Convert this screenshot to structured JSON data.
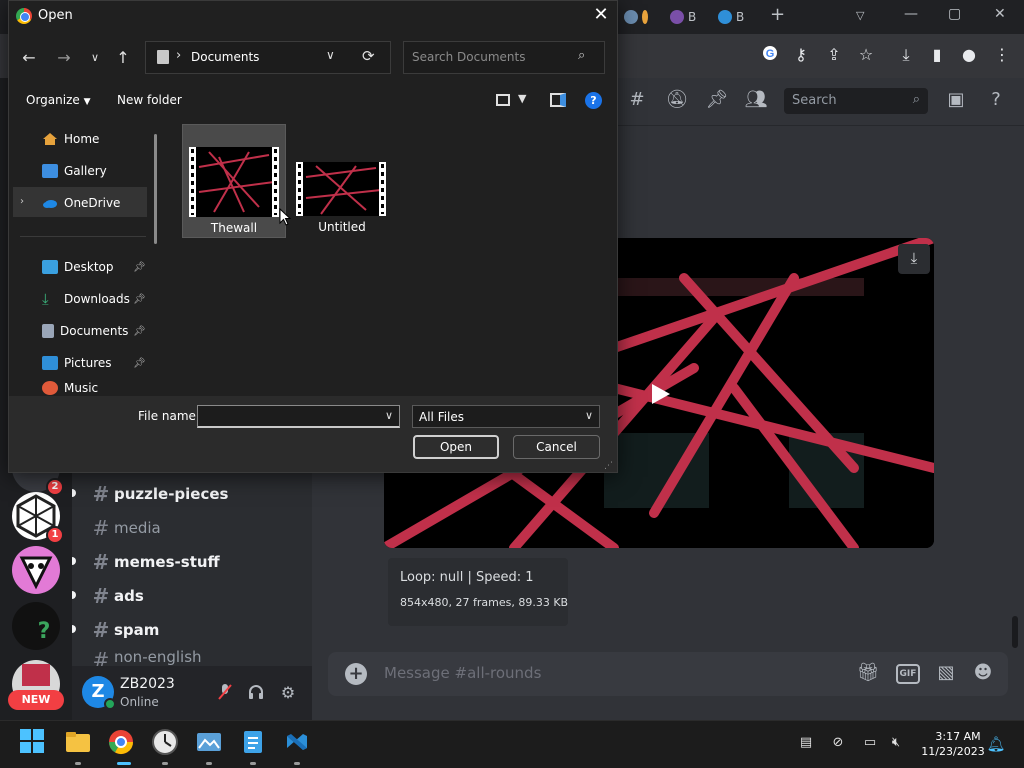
{
  "dialog": {
    "title": "Open",
    "address": "Documents",
    "search_placeholder": "Search Documents",
    "organize_label": "Organize",
    "new_folder_label": "New folder",
    "nav_items": [
      {
        "label": "Home",
        "pinned": false
      },
      {
        "label": "Gallery",
        "pinned": false
      },
      {
        "label": "OneDrive",
        "pinned": false
      },
      {
        "label": "Desktop",
        "pinned": true
      },
      {
        "label": "Downloads",
        "pinned": true
      },
      {
        "label": "Documents",
        "pinned": true
      },
      {
        "label": "Pictures",
        "pinned": true
      },
      {
        "label": "Music",
        "pinned": true
      }
    ],
    "files": [
      {
        "name": "Thewall",
        "selected": true
      },
      {
        "name": "Untitled",
        "selected": false
      }
    ],
    "file_name_label": "File name:",
    "file_name_value": "",
    "file_type": "All Files",
    "open_label": "Open",
    "cancel_label": "Cancel"
  },
  "browser": {
    "tab_labels": [
      "B",
      "B"
    ],
    "window_controls": [
      "—",
      "▢",
      "✕"
    ]
  },
  "discord": {
    "search_placeholder": "Search",
    "guild_badges": [
      "2",
      "1"
    ],
    "new_badge": "NEW",
    "channels": [
      {
        "name": "puzzle-pieces",
        "unread": true
      },
      {
        "name": "media",
        "unread": false
      },
      {
        "name": "memes-stuff",
        "unread": true
      },
      {
        "name": "ads",
        "unread": true
      },
      {
        "name": "spam",
        "unread": true
      },
      {
        "name": "non-english",
        "unread": false
      }
    ],
    "user": {
      "name": "ZB2023",
      "status": "Online",
      "avatar_letter": "Z"
    },
    "embed": {
      "line1": "Loop: null | Speed: 1",
      "line2": "854x480, 27 frames, 89.33 KB"
    },
    "message_placeholder": "Message #all-rounds",
    "gif_label": "GIF"
  },
  "taskbar": {
    "time": "3:17 AM",
    "date": "11/23/2023"
  },
  "colors": {
    "accent_red": "#c0304a",
    "discord_bg": "#313338",
    "dialog_bg": "#202020"
  }
}
